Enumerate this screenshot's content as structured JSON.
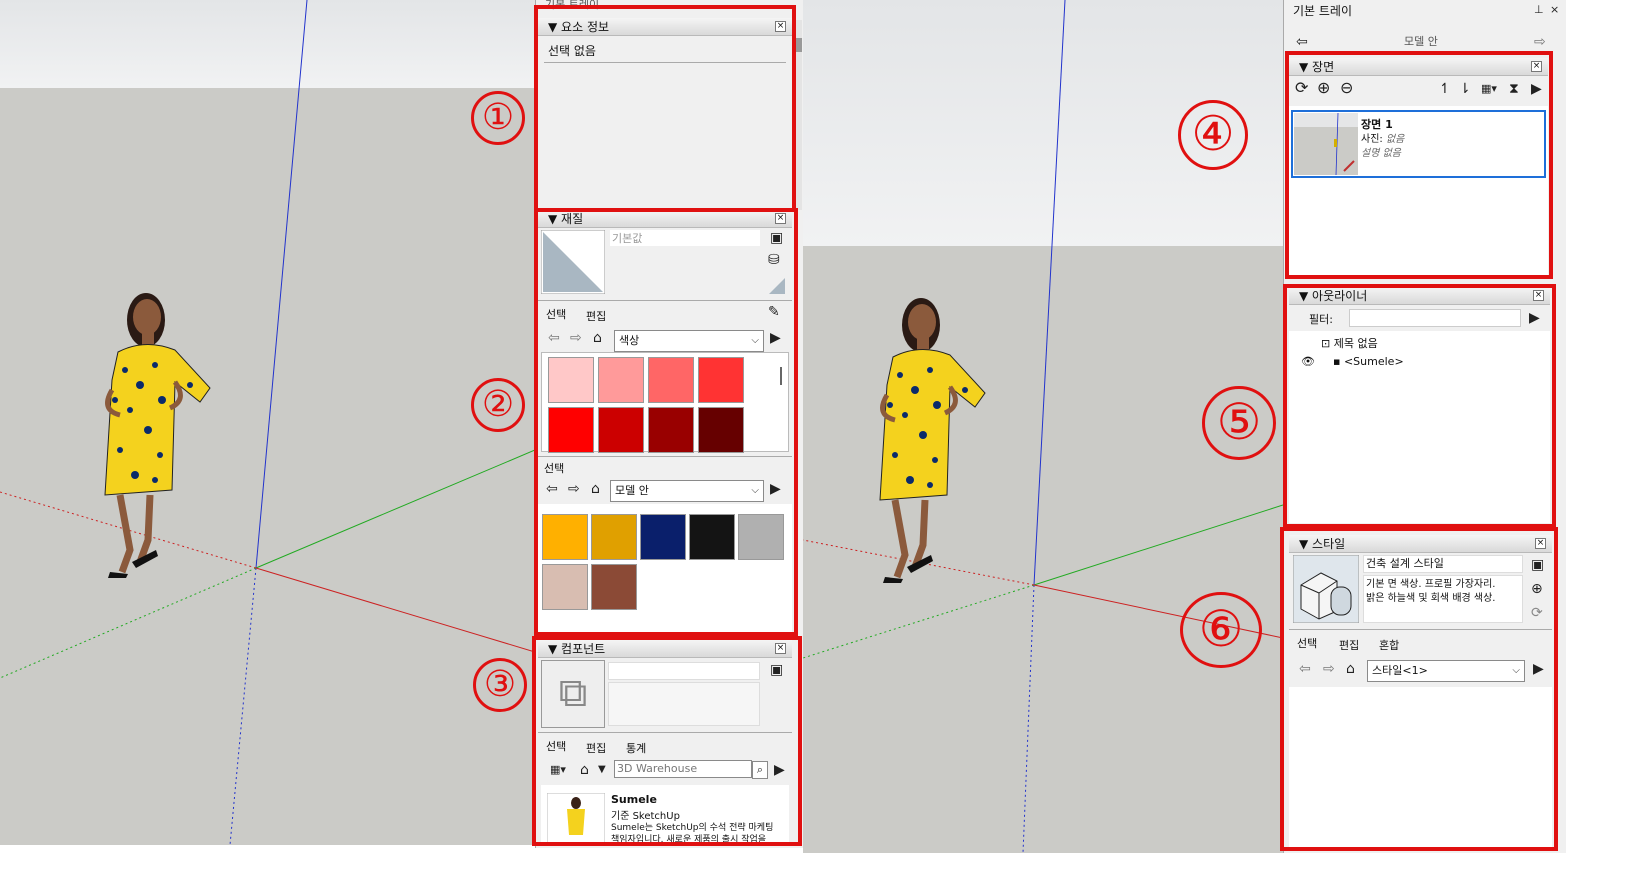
{
  "annotations": [
    "①",
    "②",
    "③",
    "④",
    "⑤",
    "⑥"
  ],
  "left": {
    "tray_title": "기본 트레이",
    "entity_info": {
      "title": "요소 정보",
      "text": "선택 없음"
    },
    "materials": {
      "title": "재질",
      "default_name": "기본값",
      "tabs": [
        "선택",
        "편집"
      ],
      "collection": "색상",
      "select_label": "선택",
      "collection2": "모델 안",
      "reds": [
        "#ffc8c8",
        "#ff9a9a",
        "#ff6666",
        "#ff3333",
        "#ff0000",
        "#cc0000",
        "#990000",
        "#660000"
      ],
      "model_colors": [
        "#ffb000",
        "#e0a000",
        "#0a1f6b",
        "#141414",
        "#b0b0b0",
        "#d8bdb1",
        "#8b4a36"
      ]
    },
    "components": {
      "title": "컴포넌트",
      "tabs": [
        "선택",
        "편집",
        "통계"
      ],
      "search_placeholder": "3D Warehouse",
      "item_name": "Sumele",
      "item_by": "기준 SketchUp",
      "item_desc1": "Sumele는 SketchUp의 수석 전략 마케팅",
      "item_desc2": "책임자입니다. 새로운 제품의 출시 작업을"
    }
  },
  "right": {
    "tray_title": "기본 트레이",
    "top_label": "모델 안",
    "scenes": {
      "title": "장면",
      "scene_name": "장면 1",
      "photo_label": "사진:",
      "photo_value": "없음",
      "desc_label": "설명 없음"
    },
    "outliner": {
      "title": "아웃라이너",
      "filter_label": "필터:",
      "root": "제목 없음",
      "child": "<Sumele>"
    },
    "styles": {
      "title": "스타일",
      "style_name": "건축 설계 스타일",
      "desc1": "기본 면 색상. 프로필 가장자리.",
      "desc2": "밝은 하늘색 및 회색 배경 색상.",
      "tabs": [
        "선택",
        "편집",
        "혼합"
      ],
      "collection": "스타일<1>"
    }
  },
  "icons": [
    "home-icon",
    "back-arrow-icon",
    "forward-arrow-icon",
    "details-icon",
    "close-icon",
    "pin-icon",
    "eyedropper-icon",
    "search-icon",
    "eye-icon",
    "component-icon",
    "refresh-icon",
    "add-icon",
    "remove-icon"
  ],
  "colors": {
    "accent_red": "#e01010",
    "ground": "#cbcbc7",
    "axis_blue": "#2233cc",
    "axis_red": "#cc2222",
    "axis_green": "#22aa22",
    "scene_border": "#1e6fd9"
  }
}
